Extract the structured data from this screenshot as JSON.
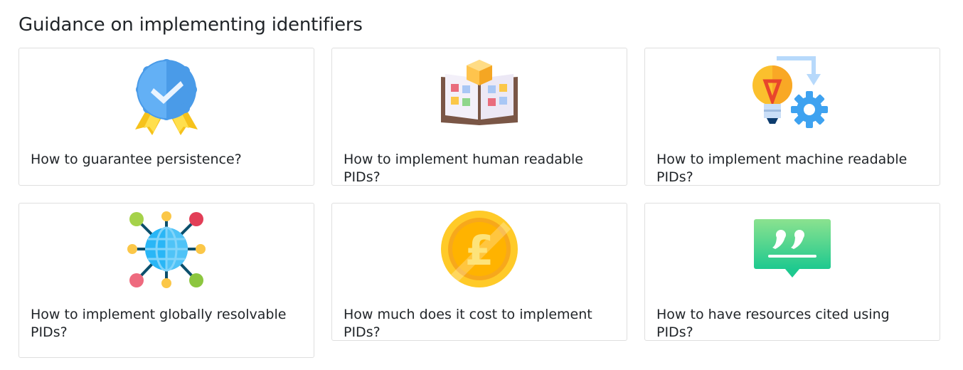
{
  "section": {
    "title": "Guidance on implementing identifiers"
  },
  "cards": [
    {
      "label": "How to guarantee persistence?",
      "icon": "award-badge-icon"
    },
    {
      "label": "How to implement human readable PIDs?",
      "icon": "open-book-icon"
    },
    {
      "label": "How to implement machine readable PIDs?",
      "icon": "lightbulb-gear-icon"
    },
    {
      "label": "How to implement globally resolvable PIDs?",
      "icon": "globe-network-icon"
    },
    {
      "label": "How much does it cost to implement PIDs?",
      "icon": "pound-coin-icon"
    },
    {
      "label": "How to have resources cited using PIDs?",
      "icon": "quote-bubble-icon"
    }
  ]
}
